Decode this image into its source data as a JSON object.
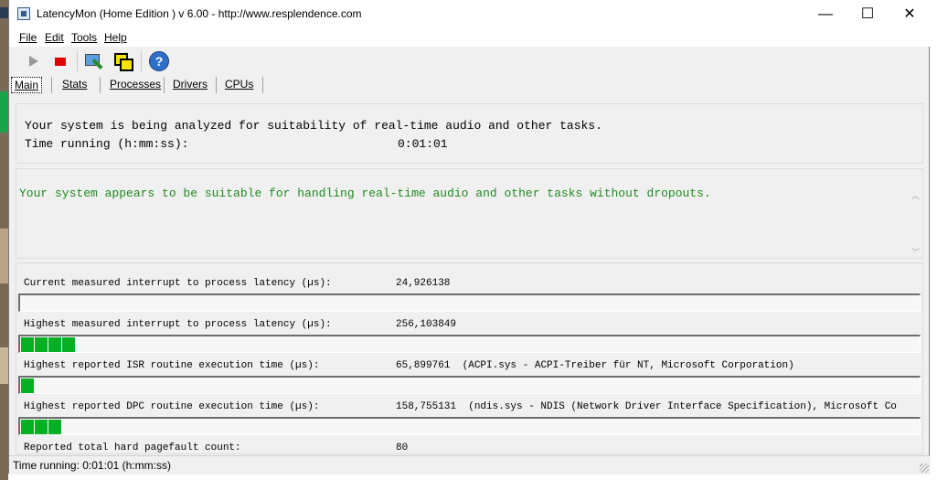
{
  "window": {
    "title": "LatencyMon  (Home Edition )  v 6.00 - http://www.resplendence.com",
    "controls": {
      "minimize": "—",
      "maximize": "☐",
      "close": "✕"
    }
  },
  "menu": {
    "file": "File",
    "edit": "Edit",
    "tools": "Tools",
    "help": "Help"
  },
  "toolbar": {
    "start": "play-icon",
    "stop": "stop-icon",
    "monitor": "monitor-icon",
    "windows": "windows-icon",
    "help": "?"
  },
  "tabs": [
    {
      "label": "Main",
      "active": true
    },
    {
      "label": "Stats"
    },
    {
      "label": "Processes"
    },
    {
      "label": "Drivers"
    },
    {
      "label": "CPUs"
    }
  ],
  "main": {
    "analyzing_text": "Your system is being analyzed for suitability of real-time audio and other tasks.",
    "time_label": "Time running (h:mm:ss):",
    "time_value": "0:01:01",
    "conclusion": "Your system appears to be suitable for handling real-time audio and other tasks without dropouts.",
    "conclusion_color": "#1f8a1f",
    "metrics": [
      {
        "label": "Current measured interrupt to process latency (µs):",
        "value": "24,926138",
        "detail": "",
        "bar_segments": 0
      },
      {
        "label": "Highest measured interrupt to process latency (µs):",
        "value": "256,103849",
        "detail": "",
        "bar_segments": 4
      },
      {
        "label": "Highest reported ISR routine execution time (µs):",
        "value": "65,899761",
        "detail": "(ACPI.sys - ACPI-Treiber für NT, Microsoft Corporation)",
        "bar_segments": 1
      },
      {
        "label": "Highest reported DPC routine execution time (µs):",
        "value": "158,755131",
        "detail": "(ndis.sys - NDIS (Network Driver Interface Specification), Microsoft Co",
        "bar_segments": 3
      },
      {
        "label": "Reported total hard pagefault count:",
        "value": "80",
        "detail": "",
        "bar_segments": 0
      }
    ],
    "bar_color": "#06b025"
  },
  "status": {
    "text": "Time running: 0:01:01  (h:mm:ss)"
  }
}
